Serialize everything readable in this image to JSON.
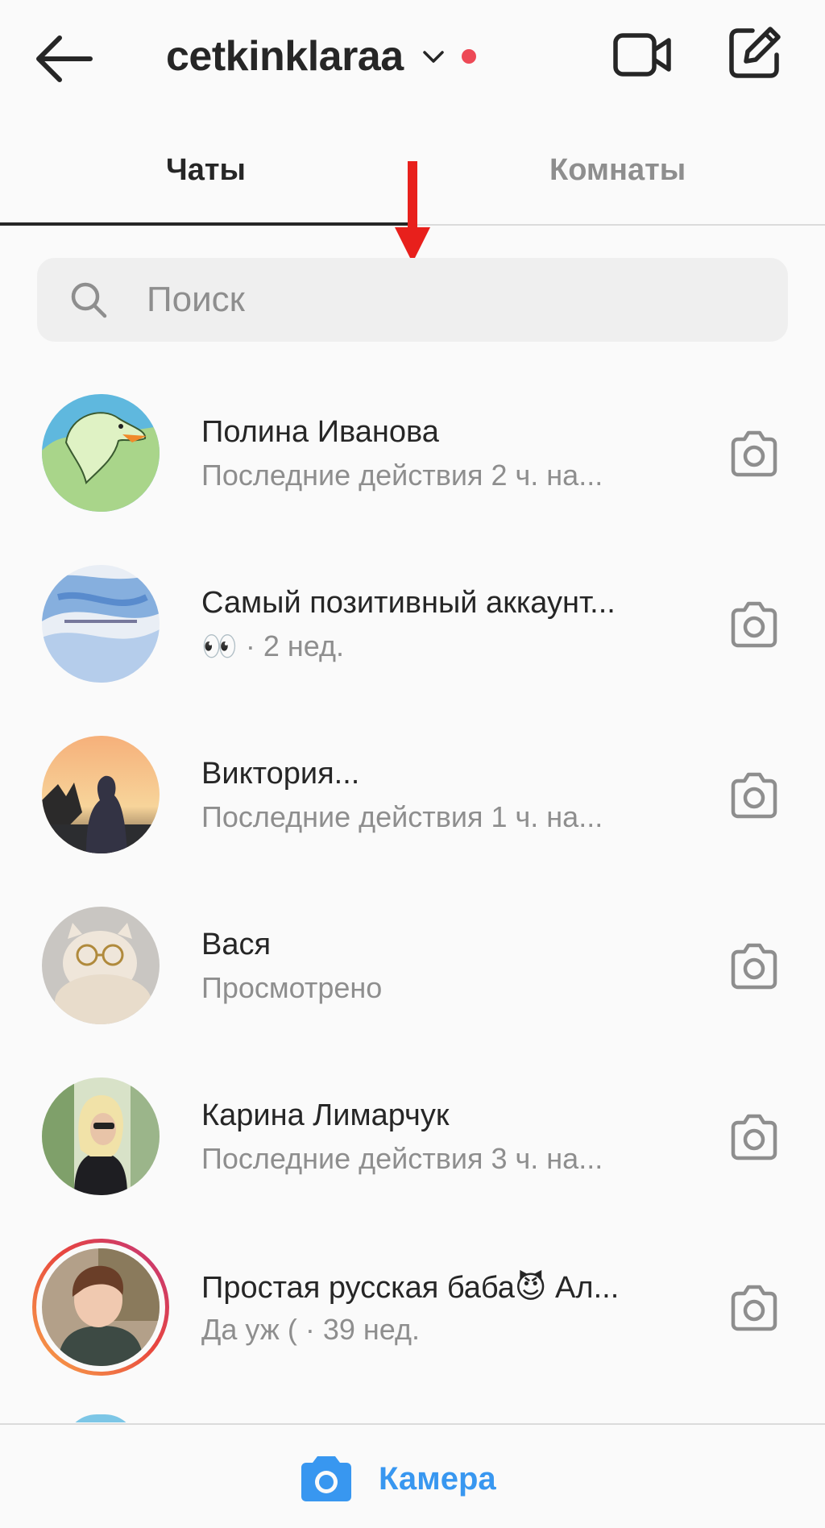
{
  "header": {
    "account_name": "cetkinklaraa",
    "back_icon": "arrow-left-icon",
    "dropdown_icon": "chevron-down-icon",
    "notification_dot_color": "#ed4956",
    "video_icon": "video-camera-icon",
    "compose_icon": "compose-icon"
  },
  "tabs": [
    {
      "label": "Чаты",
      "active": true
    },
    {
      "label": "Комнаты",
      "active": false
    }
  ],
  "annotation": {
    "arrow_color": "#e8201c",
    "arrow_icon": "arrow-down-icon"
  },
  "search": {
    "placeholder": "Поиск",
    "value": "",
    "icon": "search-icon"
  },
  "chats": [
    {
      "name": "Полина Иванова",
      "subtitle": "Последние действия 2 ч. на..."
    },
    {
      "name": "Самый позитивный аккаунт...",
      "subtitle": "👀 · 2 нед."
    },
    {
      "name": "Виктория...",
      "subtitle": "Последние действия 1 ч. на..."
    },
    {
      "name": "Вася",
      "subtitle": "Просмотрено"
    },
    {
      "name": "Карина Лимарчук",
      "subtitle": "Последние действия 3 ч. на..."
    },
    {
      "name": "Простая русская баба😈 Ал...",
      "subtitle": "Да уж ( · 39 нед.",
      "story_ring": true
    }
  ],
  "bottom_bar": {
    "label": "Камера",
    "icon": "camera-icon",
    "accent": "#3897f0"
  }
}
